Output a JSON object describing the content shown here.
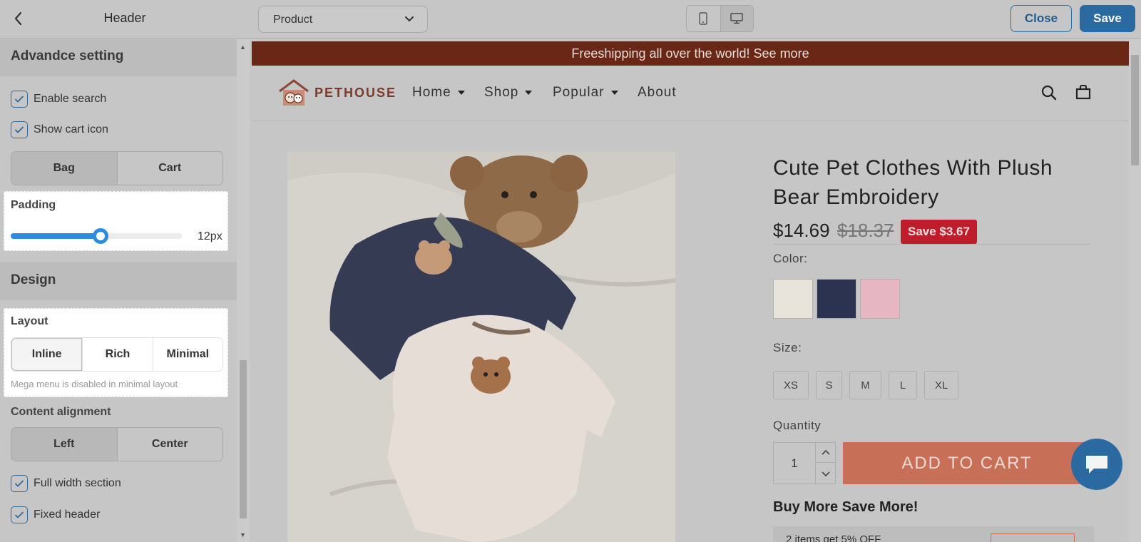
{
  "topbar": {
    "panel_title": "Header",
    "page_select_value": "Product",
    "close_label": "Close",
    "save_label": "Save",
    "icons": [
      "back-chevron-icon",
      "chevron-down-icon",
      "mobile-icon",
      "desktop-icon"
    ]
  },
  "sidebar": {
    "advanced": {
      "heading": "Advandce setting",
      "enable_search": "Enable search",
      "show_cart_icon": "Show cart icon",
      "cart_style_options": [
        "Bag",
        "Cart"
      ],
      "cart_style_selected": "Bag",
      "padding_label": "Padding",
      "padding_value_text": "12px",
      "padding_value": 12,
      "padding_fraction": 0.5
    },
    "design": {
      "heading": "Design",
      "layout_label": "Layout",
      "layout_options": [
        "Inline",
        "Rich",
        "Minimal"
      ],
      "layout_selected": "Inline",
      "layout_hint": "Mega menu is disabled in minimal layout",
      "alignment_label": "Content alignment",
      "alignment_options": [
        "Left",
        "Center"
      ],
      "alignment_selected": "Left",
      "full_width": "Full width section",
      "fixed_header": "Fixed header"
    }
  },
  "preview": {
    "announcement": "Freeshipping all over the world! See more",
    "logo_text": "PETHOUSE",
    "nav": [
      {
        "label": "Home",
        "dropdown": true
      },
      {
        "label": "Shop",
        "dropdown": true
      },
      {
        "label": "Popular",
        "dropdown": true
      },
      {
        "label": "About",
        "dropdown": false
      }
    ],
    "product": {
      "title": "Cute Pet Clothes With Plush Bear Embroidery",
      "price": "$14.69",
      "compare_price": "$18.37",
      "save_badge": "Save $3.67",
      "color_label": "Color:",
      "swatch_colors": [
        "#e8e4dc",
        "#2c3350",
        "#e6b6c3"
      ],
      "size_label": "Size:",
      "sizes": [
        "XS",
        "S",
        "M",
        "L",
        "XL"
      ],
      "quantity_label": "Quantity",
      "quantity": "1",
      "add_to_cart": "ADD TO CART",
      "buy_more": "Buy More Save More!",
      "discount_text": "2 items get 5% OFF"
    }
  },
  "colors": {
    "accent": "#2a6aa0",
    "announcement_bg": "#6b2716",
    "add_to_cart_bg": "#c87057",
    "save_badge_bg": "#bf1d2c"
  }
}
